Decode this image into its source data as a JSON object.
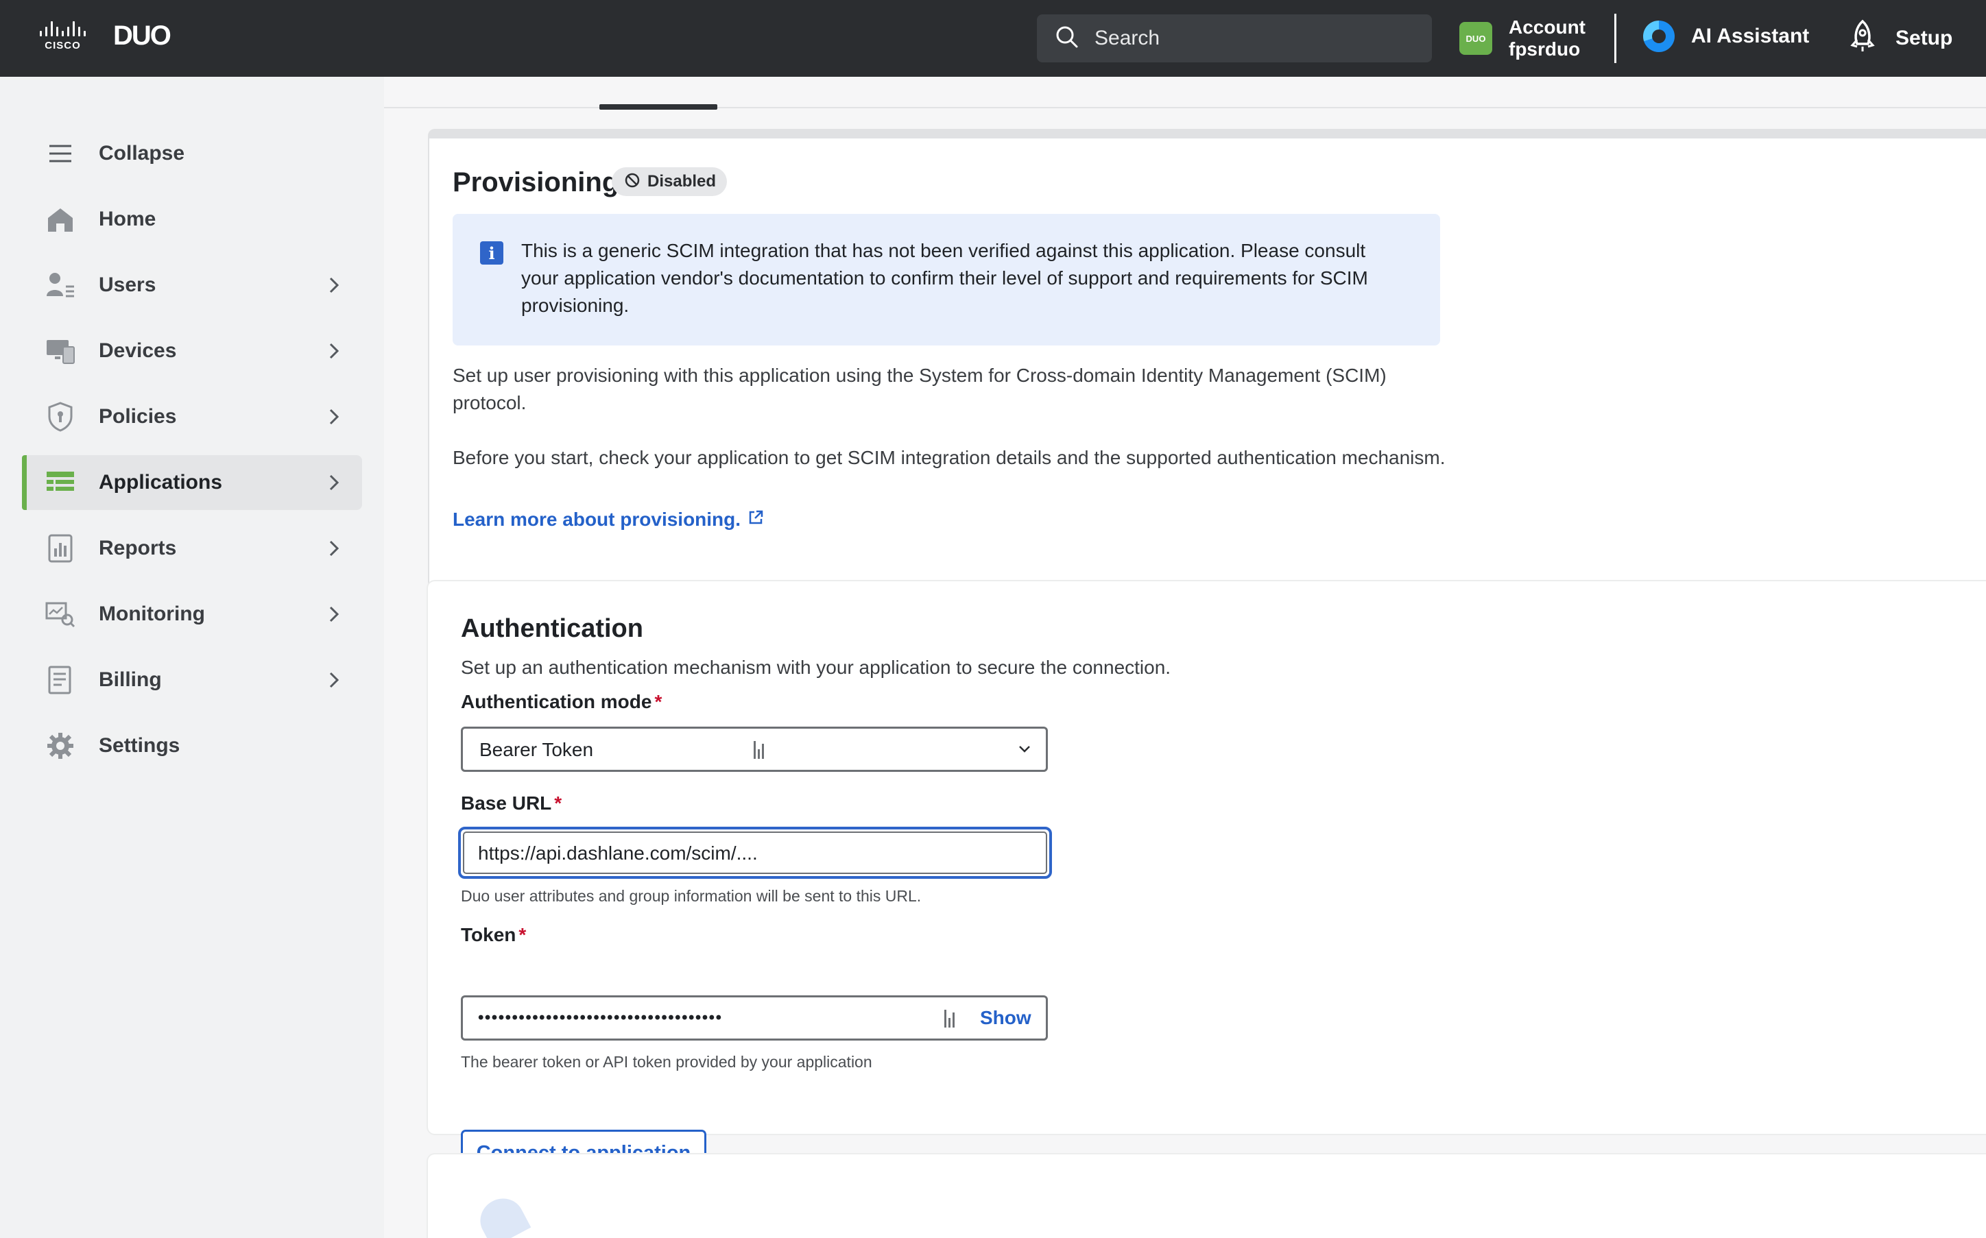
{
  "topbar": {
    "brand_cisco": "CISCO",
    "brand_duo": "DUO",
    "search_label": "Search",
    "account_label": "Account",
    "account_name": "fpsrduo",
    "account_avatar_text": "DUO",
    "ai_assistant_label": "AI Assistant",
    "setup_label": "Setup"
  },
  "sidebar": {
    "items": [
      {
        "label": "Collapse",
        "icon": "menu-icon",
        "chevron": false
      },
      {
        "label": "Home",
        "icon": "home-icon",
        "chevron": false
      },
      {
        "label": "Users",
        "icon": "users-icon",
        "chevron": true
      },
      {
        "label": "Devices",
        "icon": "devices-icon",
        "chevron": true
      },
      {
        "label": "Policies",
        "icon": "shield-icon",
        "chevron": true
      },
      {
        "label": "Applications",
        "icon": "applications-icon",
        "chevron": true,
        "active": true
      },
      {
        "label": "Reports",
        "icon": "reports-icon",
        "chevron": true
      },
      {
        "label": "Monitoring",
        "icon": "monitoring-icon",
        "chevron": true
      },
      {
        "label": "Billing",
        "icon": "billing-icon",
        "chevron": true
      },
      {
        "label": "Settings",
        "icon": "gear-icon",
        "chevron": false
      }
    ],
    "accent_color": "#6ab04c"
  },
  "provisioning": {
    "title": "Provisioning",
    "status_badge": "Disabled",
    "info_text": "This is a generic SCIM integration that has not been verified against this application. Please consult your application vendor's documentation to confirm their level of support and requirements for SCIM provisioning.",
    "paragraph_1": "Set up user provisioning with this application using the System for Cross-domain Identity Management (SCIM) protocol.",
    "paragraph_2": "Before you start, check your application to get SCIM integration details and the supported authentication mechanism.",
    "learn_more_link": "Learn more about provisioning."
  },
  "authentication": {
    "title": "Authentication",
    "description": "Set up an authentication mechanism with your application to secure the connection.",
    "mode_label": "Authentication mode",
    "mode_value": "Bearer Token",
    "base_url_label": "Base URL",
    "base_url_value": "https://api.dashlane.com/scim/....",
    "base_url_help": "Duo user attributes and group information will be sent to this URL.",
    "token_label": "Token",
    "token_value": "••••••••••••••••••••••••••••••••••••",
    "token_show": "Show",
    "token_help": "The bearer token or API token provided by your application",
    "connect_button": "Connect to application",
    "required_mark": "*"
  },
  "colors": {
    "topbar_bg": "#2b2d30",
    "link_blue": "#2461c9",
    "focus_blue": "#2f65c9",
    "info_bg": "#e8effc",
    "required_red": "#c8102e"
  }
}
